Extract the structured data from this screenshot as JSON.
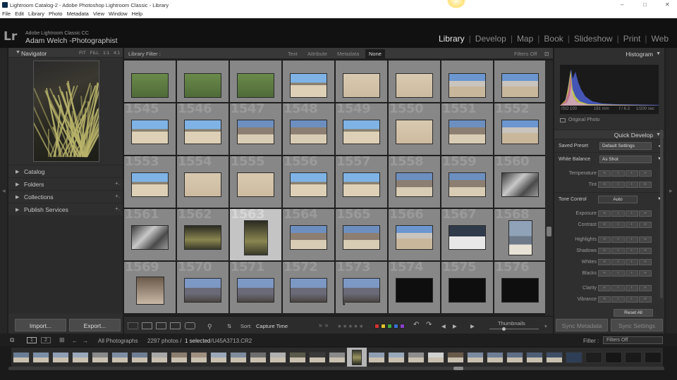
{
  "window": {
    "title": "Lightroom Catalog-2 - Adobe Photoshop Lightroom Classic - Library",
    "controls": {
      "minimize": "–",
      "maximize": "□",
      "close": "✕"
    }
  },
  "menu": [
    "File",
    "Edit",
    "Library",
    "Photo",
    "Metadata",
    "View",
    "Window",
    "Help"
  ],
  "identity": {
    "logo": "Lr",
    "product": "Adobe Lightroom Classic CC",
    "owner": "Adam Welch -Photographist"
  },
  "modules": [
    "Library",
    "Develop",
    "Map",
    "Book",
    "Slideshow",
    "Print",
    "Web"
  ],
  "active_module": "Library",
  "left_panel": {
    "navigator": {
      "title": "Navigator",
      "zoom_fit": "FIT",
      "zoom_fill": "FILL",
      "zoom_1": "1:1",
      "zoom_4": "4:1"
    },
    "sections": [
      {
        "label": "Catalog",
        "plus": ""
      },
      {
        "label": "Folders",
        "plus": "+."
      },
      {
        "label": "Collections",
        "plus": "+."
      },
      {
        "label": "Publish Services",
        "plus": "+."
      }
    ],
    "import_label": "Import...",
    "export_label": "Export..."
  },
  "filter_bar": {
    "label": "Library Filter :",
    "options": [
      "Text",
      "Attribute",
      "Metadata",
      "None"
    ],
    "active": "None",
    "filters_state": "Filters Off"
  },
  "grid": {
    "rows": [
      {
        "numbers": [
          "",
          "",
          "",
          "",
          "",
          "",
          "",
          ""
        ]
      },
      {
        "numbers": [
          "1545",
          "1546",
          "1547",
          "1548",
          "1549",
          "1550",
          "1551",
          "1552"
        ]
      },
      {
        "numbers": [
          "1553",
          "1554",
          "1555",
          "1556",
          "1557",
          "1558",
          "1559",
          "1560"
        ]
      },
      {
        "numbers": [
          "1561",
          "1562",
          "1563",
          "1564",
          "1565",
          "1566",
          "1567",
          "1568"
        ]
      },
      {
        "numbers": [
          "1569",
          "1570",
          "1571",
          "1572",
          "1573",
          "1574",
          "1575",
          "1576"
        ]
      }
    ],
    "selected_number": "1563",
    "star_text": "★"
  },
  "toolbar": {
    "sort_label": "Sort:",
    "sort_value": "Capture Time",
    "rating_stars": "★★★★★",
    "label_colors": [
      "#d33333",
      "#e0c230",
      "#3fae3f",
      "#3a6fd1",
      "#8a3fc6"
    ],
    "thumbnails_label": "Thumbnails"
  },
  "right_panel": {
    "histogram_title": "Histogram",
    "exif": {
      "iso": "ISO 100",
      "focal": "181 mm",
      "aperture": "f / 6.3",
      "shutter": "1/200 sec"
    },
    "original_photo": "Original Photo",
    "quick_develop_title": "Quick Develop",
    "saved_preset_label": "Saved Preset",
    "saved_preset_value": "Default Settings",
    "white_balance_label": "White Balance",
    "white_balance_value": "As Shot",
    "temperature_label": "Temperature",
    "tint_label": "Tint",
    "tone_control_label": "Tone Control",
    "auto_label": "Auto",
    "sliders": [
      "Exposure",
      "Contrast",
      "Highlights",
      "Shadows",
      "Whites",
      "Blacks",
      "Clarity",
      "Vibrance"
    ],
    "step_glyphs": [
      "‹‹",
      "‹",
      "›",
      "››"
    ],
    "reset_label": "Reset All",
    "sync_metadata": "Sync Metadata",
    "sync_settings": "Sync Settings"
  },
  "filmstrip": {
    "page1": "1",
    "page2": "2",
    "source": "All Photographs",
    "count": "2297 photos /",
    "selected": "1 selected",
    "filename": "/U45A3713.CR2",
    "filter_label": "Filter :",
    "filter_value": "Filters Off"
  }
}
